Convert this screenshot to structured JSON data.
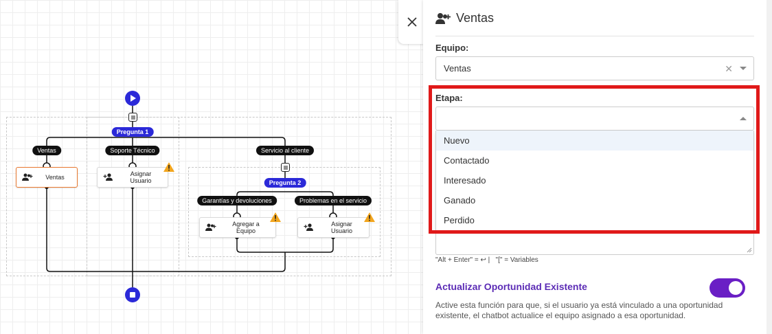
{
  "canvas": {
    "question_1": "Pregunta 1",
    "question_2": "Pregunta 2",
    "branches": {
      "ventas": "Ventas",
      "soporte": "Soporte Técnico",
      "servicio": "Servicio al cliente",
      "garantias": "Garantías y devoluciones",
      "problemas": "Problemas en el servicio"
    },
    "nodes": {
      "ventas": "Ventas",
      "asignar_1": "Asignar Usuario",
      "agregar_equipo": "Agregar a Equipo",
      "asignar_2": "Asignar Usuario"
    }
  },
  "panel": {
    "title": "Ventas",
    "equipo_label": "Equipo:",
    "equipo_value": "Ventas",
    "etapa_label": "Etapa:",
    "etapa_options": [
      "Nuevo",
      "Contactado",
      "Interesado",
      "Ganado",
      "Perdido"
    ],
    "hint": "\"Alt + Enter\" = ↩ |   \"[\" = Variables",
    "toggle_title": "Actualizar Oportunidad Existente",
    "toggle_on": true,
    "description": "Active esta función para que, si el usuario ya está vinculado a una oportunidad existente, el chatbot actualice el equipo asignado a esa oportunidad."
  },
  "colors": {
    "accent": "#2b29d8",
    "toggle": "#6a1fc5",
    "highlight": "#e01919",
    "selected_node": "#e8782f"
  }
}
